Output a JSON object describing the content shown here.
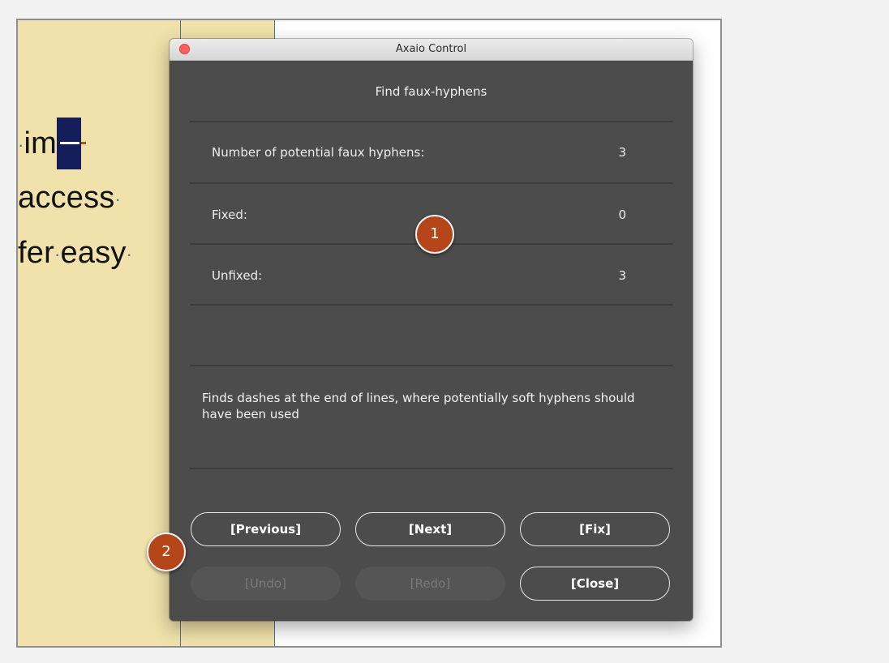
{
  "document": {
    "line1": {
      "prefix": "·",
      "word": "im"
    },
    "line2": {
      "word": "access",
      "suffix": "·"
    },
    "line3": {
      "word1": "fer",
      "sep": "·",
      "word2": "easy",
      "suffix": "·"
    }
  },
  "dialog": {
    "title": "Axaio Control",
    "heading": "Find faux-hyphens",
    "rows": [
      {
        "label": "Number of potential faux hyphens:",
        "value": "3"
      },
      {
        "label": "Fixed:",
        "value": "0"
      },
      {
        "label": "Unfixed:",
        "value": "3"
      }
    ],
    "description": "Finds dashes at the end of lines, where potentially soft hyphens should have been used",
    "buttons": {
      "previous": "[Previous]",
      "next": "[Next]",
      "fix": "[Fix]",
      "undo": "[Undo]",
      "redo": "[Redo]",
      "close": "[Close]"
    }
  },
  "callouts": {
    "one": "1",
    "two": "2"
  },
  "colors": {
    "dialog_bg": "#4c4c4c",
    "page_bg": "#f0e2aa",
    "callout": "#b5461a",
    "selection": "#141d5a",
    "close_dot": "#fc605c"
  }
}
